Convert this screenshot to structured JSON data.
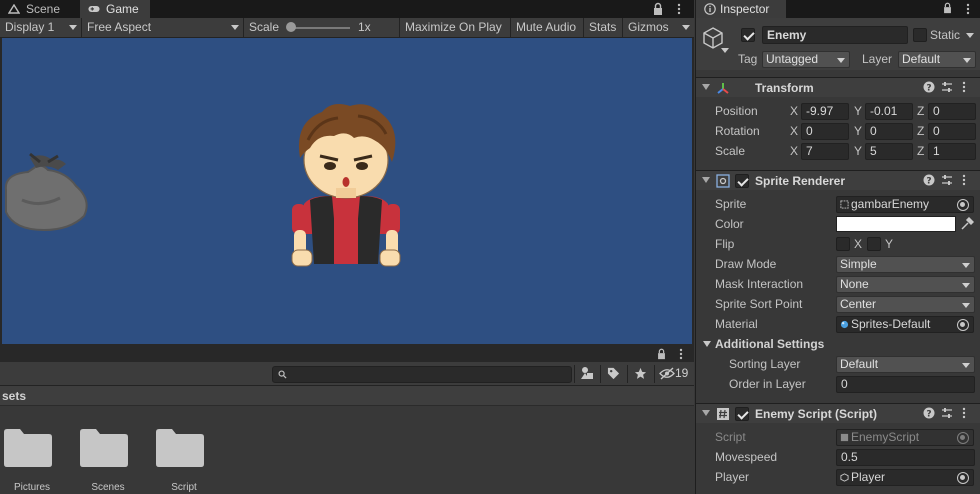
{
  "scene_tabs": [
    {
      "label": "Scene"
    },
    {
      "label": "Game"
    }
  ],
  "game_toolbar": {
    "display": "Display 1",
    "aspect": "Free Aspect",
    "scale_label": "Scale",
    "scale_value": "1x",
    "scale_level": 0.0,
    "maximize": "Maximize On Play",
    "mute": "Mute Audio",
    "stats": "Stats",
    "gizmos": "Gizmos"
  },
  "project": {
    "hidden_count": "19",
    "breadcrumb": "sets",
    "folders": [
      {
        "label": "Pictures"
      },
      {
        "label": "Scenes"
      },
      {
        "label": "Script"
      }
    ]
  },
  "inspector": {
    "tab_label": "Inspector",
    "object_name": "Enemy",
    "static_label": "Static",
    "tag_label": "Tag",
    "tag_value": "Untagged",
    "layer_label": "Layer",
    "layer_value": "Default",
    "transform": {
      "title": "Transform",
      "position_label": "Position",
      "position": {
        "x": "-9.97",
        "y": "-0.01",
        "z": "0"
      },
      "rotation_label": "Rotation",
      "rotation": {
        "x": "0",
        "y": "0",
        "z": "0"
      },
      "scale_label": "Scale",
      "scale": {
        "x": "7",
        "y": "5",
        "z": "1"
      },
      "axis_x": "X",
      "axis_y": "Y",
      "axis_z": "Z"
    },
    "sprite_renderer": {
      "title": "Sprite Renderer",
      "sprite_label": "Sprite",
      "sprite_value": "gambarEnemy",
      "color_label": "Color",
      "color_value": "#ffffff",
      "flip_label": "Flip",
      "flip_x": "X",
      "flip_y": "Y",
      "draw_mode_label": "Draw Mode",
      "draw_mode": "Simple",
      "mask_label": "Mask Interaction",
      "mask": "None",
      "sort_point_label": "Sprite Sort Point",
      "sort_point": "Center",
      "material_label": "Material",
      "material": "Sprites-Default",
      "additional_settings": "Additional Settings",
      "sorting_layer_label": "Sorting Layer",
      "sorting_layer": "Default",
      "order_label": "Order in Layer",
      "order": "0"
    },
    "enemy_script": {
      "title": "Enemy Script (Script)",
      "script_label": "Script",
      "script_value": "EnemyScript",
      "movespeed_label": "Movespeed",
      "movespeed": "0.5",
      "player_label": "Player",
      "player": "Player"
    }
  },
  "colors": {
    "viewport_bg": "#2e4f82",
    "panel_bg": "#383838",
    "enemy_shirt": "#c8323c",
    "enemy_vest": "#2a2a2a",
    "enemy_hair": "#7a4a24",
    "enemy_skin": "#f9dcae"
  }
}
